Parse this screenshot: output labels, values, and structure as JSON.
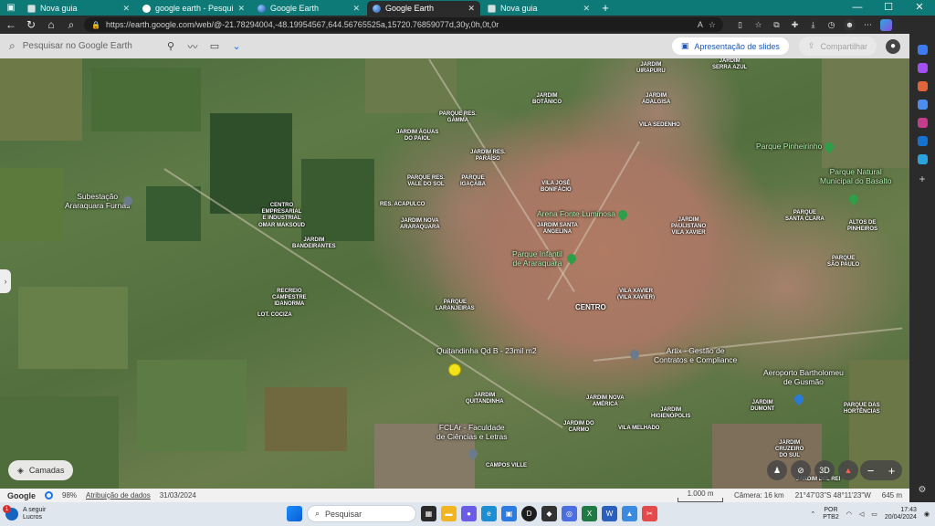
{
  "browser": {
    "tabs": [
      {
        "title": "Nova guia",
        "active": false
      },
      {
        "title": "google earth - Pesquisar",
        "active": false
      },
      {
        "title": "Google Earth",
        "active": false
      },
      {
        "title": "Google Earth",
        "active": true
      },
      {
        "title": "Nova guia",
        "active": false
      }
    ],
    "url": "https://earth.google.com/web/@-21.78294004,-48.19954567,644.56765525a,15720.76859077d,30y,0h,0t,0r"
  },
  "earth": {
    "search_placeholder": "Pesquisar no Google Earth",
    "slides_label": "Apresentação de slides",
    "share_label": "Compartilhar",
    "layers_label": "Camadas",
    "btn_3d": "3D"
  },
  "map_labels": {
    "serra_azul": "JARDIM\nSERRA AZUL",
    "uirapuru": "JARDIM\nUIRAPURU",
    "botanico": "JARDIM\nBOTÂNICO",
    "adalgisa": "JARDIM\nADALGISA",
    "res_gamma": "PARQUE RES.\nGAMMA",
    "vila_sedenho": "VILA SEDENHO",
    "aguas_paiol": "JARDIM ÁGUAS\nDO PAIOL",
    "res_paraiso": "JARDIM RES.\nPARAÍSO",
    "res_vale_sol": "PARQUE RES.\nVALE DO SOL",
    "igacaba": "PARQUE\nIGAÇABA",
    "vila_jose_bonifacio": "VILA JOSÉ\nBONIFÁCIO",
    "res_acapulco": "RES. ACAPULCO",
    "centro_empresarial": "CENTRO\nEMPRESARIAL\nE INDUSTRIAL\nOMAR MAKSOUD",
    "nova_araraquara": "JARDIM NOVA\nARARAQUARA",
    "santa_angelina": "JARDIM SANTA\nANGELINA",
    "paulistano": "JARDIM\nPAULISTANO\nVILA XAVIER",
    "santa_clara": "PARQUE\nSANTA CLARA",
    "altos_pinheiros": "ALTOS DE\nPINHEIROS",
    "bandeirantes": "JARDIM\nBANDEIRANTES",
    "sao_paulo": "PARQUE\nSÃO PAULO",
    "recreio": "RECREIO\nCAMPESTRE\nIDANORMA",
    "vila_xavier": "VILA XAVIER\n(VILA XAVIER)",
    "laranjeiras": "PARQUE\nLARANJEIRAS",
    "lot_cociza": "LOT. COCIZA",
    "centro": "CENTRO",
    "quitandinha": "JARDIM\nQUITANDINHA",
    "nova_america": "JARDIM NOVA\nAMÉRICA",
    "higienopolis": "JARDIM\nHIGIENÓPOLIS",
    "dumont": "JARDIM\nDUMONT",
    "hortencias": "PARQUE DAS\nHORTÊNCIAS",
    "vila_melhado": "VILA MELHADO",
    "do_carmo": "JARDIM DO\nCARMO",
    "cruzeiro_sul": "JARDIM\nCRUZEIRO\nDO SUL",
    "campos_ville": "CAMPOS VILLE",
    "del_rei": "JARDIM DEL REI"
  },
  "pois": {
    "subestacao": "Subestação\nAraraquara Furnas",
    "parque_pinheirinho": "Parque Pinheirinho",
    "parque_basalto": "Parque Natural\nMunicipal do Basalto",
    "arena_fonte": "Arena Fonte Luminosa",
    "parque_infantil": "Parque Infantil\nde Araraquara",
    "quitandinha_lot": "Quitandinha Qd B - 23mil m2",
    "artix": "Artix - Gestão de\nContratos e Compliance",
    "aeroporto": "Aeroporto Bartholomeu\nde Gusmão",
    "fclar": "FCLAr - Faculdade\nde Ciências e Letras"
  },
  "status": {
    "google": "Google",
    "zoom_pct": "98%",
    "attribution": "Atribuição de dados",
    "date": "31/03/2024",
    "scale": "1.000 m",
    "camera": "Câmera: 16 km",
    "coords": "21°47'03\"S 48°11'23\"W",
    "elev": "645 m"
  },
  "taskbar": {
    "weather_title": "A seguir",
    "weather_sub": "Lucros",
    "weather_badge": "1",
    "search": "Pesquisar",
    "lang1": "POR",
    "lang2": "PTB2",
    "time": "17:43",
    "date": "20/04/2024"
  }
}
